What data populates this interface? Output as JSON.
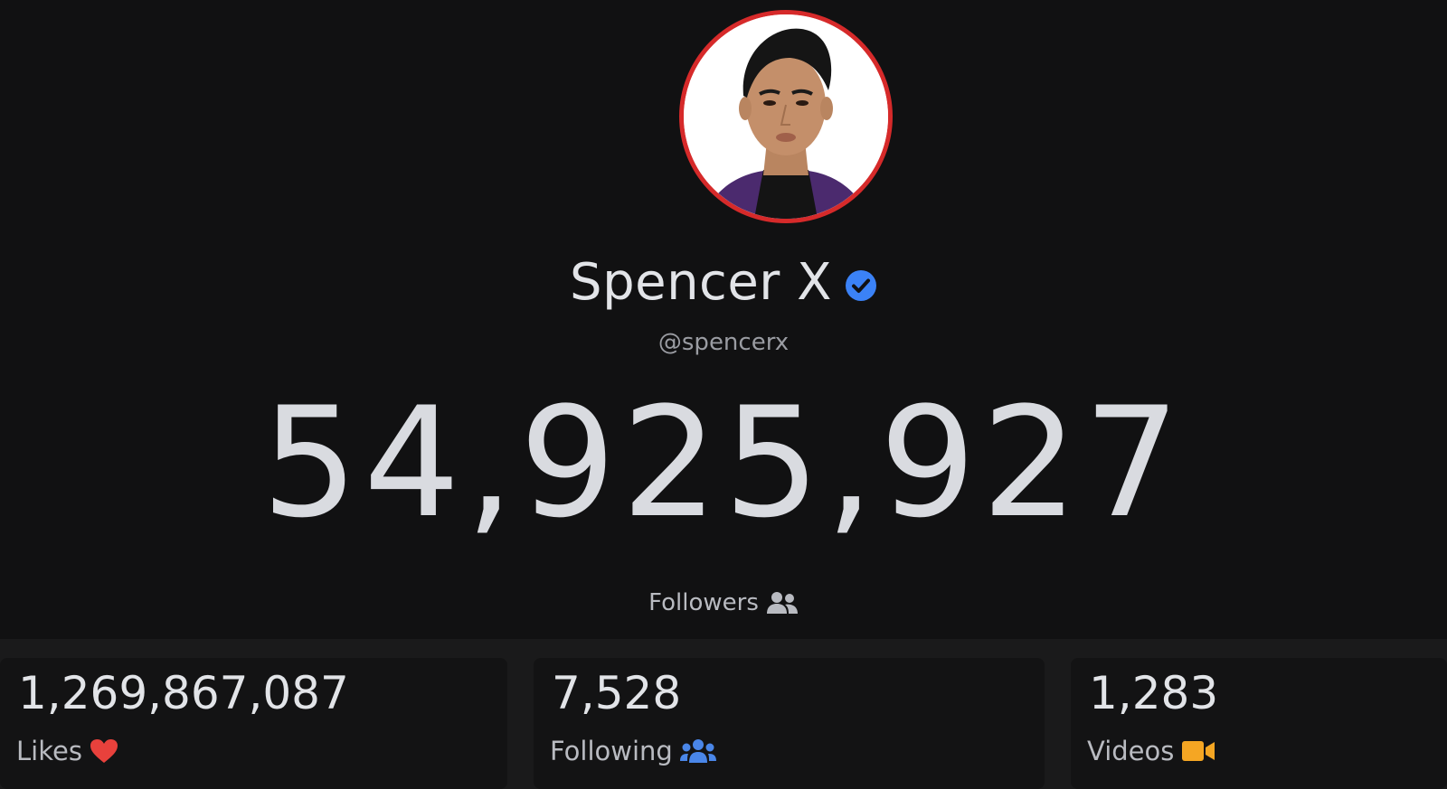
{
  "profile": {
    "name": "Spencer X",
    "handle": "@spencerx",
    "verified": true,
    "avatar_icon": "profile-photo",
    "avatar_ring_color": "#d62a2a"
  },
  "followers": {
    "count": "54,925,927",
    "label": "Followers",
    "icon": "user-group-icon"
  },
  "stats": [
    {
      "value": "1,269,867,087",
      "label": "Likes",
      "icon": "heart-icon",
      "icon_color": "#e8413c"
    },
    {
      "value": "7,528",
      "label": "Following",
      "icon": "user-group-icon",
      "icon_color": "#4a86e8"
    },
    {
      "value": "1,283",
      "label": "Videos",
      "icon": "video-camera-icon",
      "icon_color": "#f5a623"
    }
  ],
  "colors": {
    "background": "#111112",
    "verified_badge": "#3b82f6"
  }
}
